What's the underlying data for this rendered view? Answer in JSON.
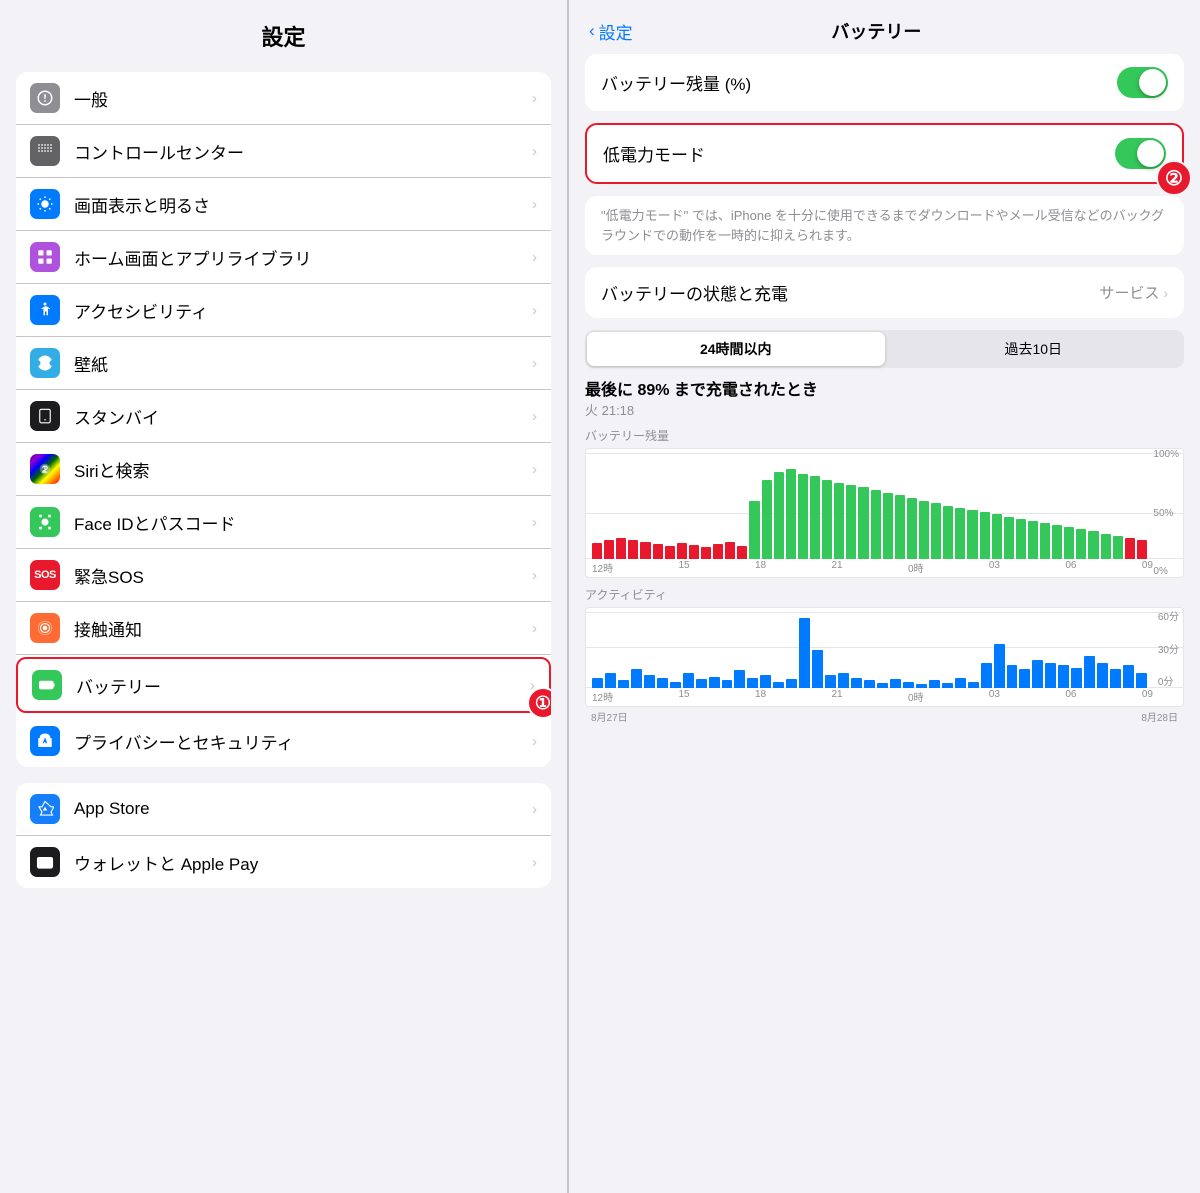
{
  "left": {
    "title": "設定",
    "items": [
      {
        "id": "general",
        "label": "一般",
        "iconBg": "icon-gray",
        "icon": "gear"
      },
      {
        "id": "control-center",
        "label": "コントロールセンター",
        "iconBg": "icon-dark-gray",
        "icon": "sliders"
      },
      {
        "id": "display",
        "label": "画面表示と明るさ",
        "iconBg": "icon-blue",
        "icon": "sun"
      },
      {
        "id": "home-screen",
        "label": "ホーム画面とアプリライブラリ",
        "iconBg": "icon-purple",
        "icon": "grid"
      },
      {
        "id": "accessibility",
        "label": "アクセシビリティ",
        "iconBg": "icon-blue",
        "icon": "person"
      },
      {
        "id": "wallpaper",
        "label": "壁紙",
        "iconBg": "icon-teal",
        "icon": "flower"
      },
      {
        "id": "standby",
        "label": "スタンバイ",
        "iconBg": "icon-black",
        "icon": "standby"
      },
      {
        "id": "siri",
        "label": "Siriと検索",
        "iconBg": "icon-black",
        "icon": "siri"
      },
      {
        "id": "faceid",
        "label": "Face IDとパスコード",
        "iconBg": "icon-green",
        "icon": "face"
      },
      {
        "id": "sos",
        "label": "緊急SOS",
        "iconBg": "icon-red",
        "icon": "sos"
      },
      {
        "id": "contact",
        "label": "接触通知",
        "iconBg": "icon-orange-red",
        "icon": "radar"
      },
      {
        "id": "battery",
        "label": "バッテリー",
        "iconBg": "icon-green",
        "icon": "battery",
        "highlighted": true
      },
      {
        "id": "privacy",
        "label": "プライバシーとセキュリティ",
        "iconBg": "icon-blue",
        "icon": "hand"
      }
    ],
    "section2": [
      {
        "id": "appstore",
        "label": "App Store",
        "iconBg": "icon-app-store",
        "icon": "appstore"
      },
      {
        "id": "wallet",
        "label": "ウォレットと Apple Pay",
        "iconBg": "icon-black",
        "icon": "wallet"
      }
    ],
    "step1_label": "①"
  },
  "right": {
    "back_label": "設定",
    "title": "バッテリー",
    "battery_percent_label": "バッテリー残量 (%)",
    "low_power_label": "低電力モード",
    "description": "\"低電力モード\" では、iPhone を十分に使用できるまでダウンロードやメール受信などのバックグラウンドでの動作を一時的に抑えられます。",
    "battery_status_label": "バッテリーの状態と充電",
    "service_label": "サービス",
    "tab_24h": "24時間以内",
    "tab_10d": "過去10日",
    "charge_title": "最後に 89% まで充電されたとき",
    "charge_time": "火 21:18",
    "battery_chart_label": "バッテリー残量",
    "activity_chart_label": "アクティビティ",
    "x_labels_battery": [
      "12時",
      "15",
      "18",
      "21",
      "0時",
      "03",
      "06",
      "09"
    ],
    "x_labels_activity": [
      "12時",
      "15",
      "18",
      "21",
      "0時",
      "03",
      "06",
      "09"
    ],
    "y_labels_battery": [
      "100%",
      "50%",
      "0%"
    ],
    "y_labels_activity": [
      "60分",
      "30分",
      "0分"
    ],
    "date_labels": [
      "8月27日",
      "",
      "",
      "",
      "",
      "",
      "",
      "8月28日"
    ],
    "step2_label": "②"
  }
}
